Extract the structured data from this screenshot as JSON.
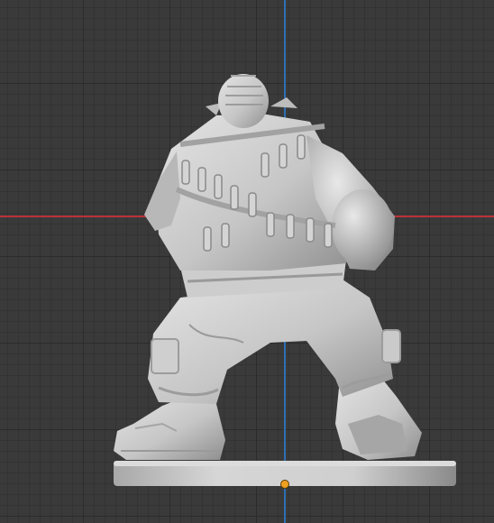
{
  "viewport": {
    "background": "#3a3a3a",
    "grid_major": "#2c2c2c",
    "grid_minor": "#333333",
    "axis_x_color": "#b8323a",
    "axis_y_color": "#2d6fb4",
    "origin_color": "#f0a020"
  },
  "model": {
    "material_color": "#c9c9c9",
    "shadow_color": "#8e8e8e",
    "highlight_color": "#e6e6e6"
  }
}
